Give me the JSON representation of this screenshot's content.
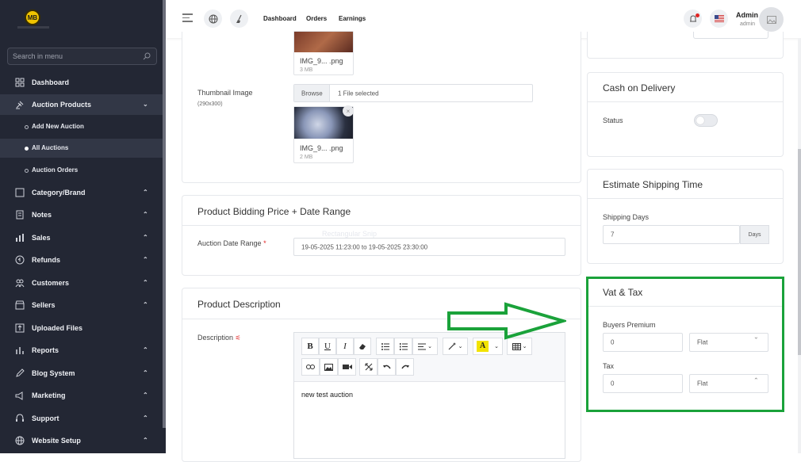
{
  "sidebar": {
    "search_placeholder": "Search in menu",
    "items": [
      {
        "label": "Dashboard",
        "icon": "dashboard-icon",
        "top": 0
      },
      {
        "label": "Auction Products",
        "icon": "gavel-icon",
        "top": 0
      },
      {
        "label": "Category/Brand",
        "icon": "tag-icon",
        "top": 0
      },
      {
        "label": "Notes",
        "icon": "note-icon",
        "top": 0
      },
      {
        "label": "Sales",
        "icon": "chart-icon",
        "top": 0
      },
      {
        "label": "Refunds",
        "icon": "refund-icon",
        "top": 0
      },
      {
        "label": "Customers",
        "icon": "users-icon",
        "top": 0
      },
      {
        "label": "Sellers",
        "icon": "store-icon",
        "top": 0
      },
      {
        "label": "Uploaded Files",
        "icon": "upload-icon",
        "top": 0
      },
      {
        "label": "Reports",
        "icon": "report-icon",
        "top": 0
      },
      {
        "label": "Blog System",
        "icon": "blog-icon",
        "top": 0
      },
      {
        "label": "Marketing",
        "icon": "megaphone-icon",
        "top": 0
      },
      {
        "label": "Support",
        "icon": "support-icon",
        "top": 0
      },
      {
        "label": "Website Setup",
        "icon": "globe-icon",
        "top": 0
      }
    ],
    "sub_items": [
      "Add New Auction",
      "All Auctions",
      "Auction Orders"
    ]
  },
  "topbar": {
    "links": [
      "Dashboard",
      "Orders",
      "Earnings"
    ],
    "user_name": "Admin",
    "user_role": "admin"
  },
  "main": {
    "top_file": {
      "name": "IMG_9... .png",
      "size": "3 MB"
    },
    "thumbnail": {
      "label": "Thumbnail Image",
      "hint": "(290x300)",
      "browse": "Browse",
      "selected": "1 File selected",
      "file": {
        "name": "IMG_9... .png",
        "size": "2 MB"
      }
    },
    "bidding": {
      "title": "Product Bidding Price + Date Range",
      "date_label": "Auction Date Range",
      "required": "*",
      "date_value": "19-05-2025 11:23:00 to 19-05-2025 23:30:00",
      "ghost_text": "Rectangular Snip"
    },
    "description": {
      "title": "Product Description",
      "label": "Description",
      "content": "new test auction"
    }
  },
  "right": {
    "cod": {
      "title": "Cash on Delivery",
      "status_label": "Status"
    },
    "shipping": {
      "title": "Estimate Shipping Time",
      "days_label": "Shipping Days",
      "days_value": "7",
      "days_suffix": "Days"
    },
    "vat": {
      "title": "Vat & Tax",
      "buyers_label": "Buyers Premium",
      "buyers_value": "0",
      "buyers_type": "Flat",
      "tax_label": "Tax",
      "tax_value": "0",
      "tax_type": "Flat"
    }
  },
  "colors": {
    "sidebar_bg": "#232734",
    "highlight_green": "#1aa23a",
    "accent_red": "#e02424"
  }
}
